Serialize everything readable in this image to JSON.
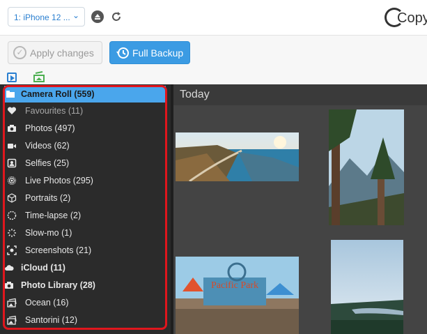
{
  "header": {
    "device_select": "1: iPhone 12 ...",
    "logo_text": "CopyTrans"
  },
  "toolbar": {
    "apply_label": "Apply changes",
    "backup_label": "Full Backup"
  },
  "sidebar": {
    "items": [
      {
        "label": "Camera Roll (559)",
        "icon": "folder-icon"
      },
      {
        "label": "Favourites (11)",
        "icon": "heart-icon"
      },
      {
        "label": "Photos (497)",
        "icon": "camera-icon"
      },
      {
        "label": "Videos (62)",
        "icon": "video-icon"
      },
      {
        "label": "Selfies (25)",
        "icon": "selfie-icon"
      },
      {
        "label": "Live Photos (295)",
        "icon": "live-photo-icon"
      },
      {
        "label": "Portraits (2)",
        "icon": "cube-icon"
      },
      {
        "label": "Time-lapse (2)",
        "icon": "timelapse-icon"
      },
      {
        "label": "Slow-mo (1)",
        "icon": "slowmo-icon"
      },
      {
        "label": "Screenshots (21)",
        "icon": "screenshot-icon"
      },
      {
        "label": "iCloud (11)",
        "icon": "cloud-icon"
      },
      {
        "label": "Photo Library (28)",
        "icon": "camera-icon"
      },
      {
        "label": "Ocean (16)",
        "icon": "album-icon"
      },
      {
        "label": "Santorini (12)",
        "icon": "album-icon"
      }
    ]
  },
  "content": {
    "section_title": "Today"
  },
  "colors": {
    "accent": "#3b9be3",
    "highlight": "#e0161d",
    "sidebar_bg": "#2b2b2b"
  }
}
